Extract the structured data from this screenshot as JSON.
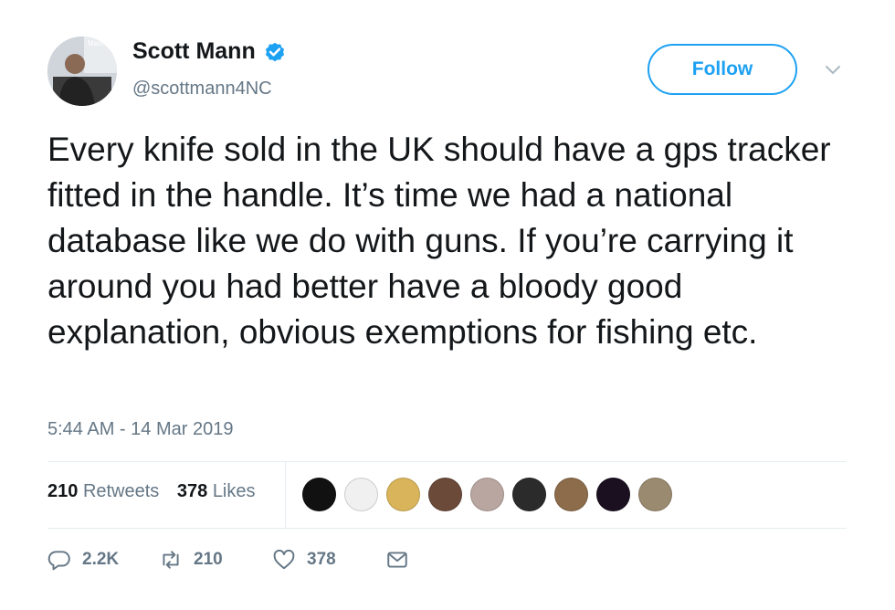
{
  "author": {
    "display_name": "Scott Mann",
    "handle": "@scottmann4NC",
    "verified": true,
    "avatar_text": "Mann"
  },
  "follow_button": {
    "label": "Follow"
  },
  "tweet": {
    "text": "Every knife sold in the UK should have a gps tracker fitted in the handle. It’s time we had a national database like we do with guns. If you’re carrying it around you had better have a bloody good explanation, obvious exemptions for fishing etc.",
    "timestamp": "5:44 AM - 14 Mar 2019"
  },
  "stats": {
    "retweets_count": "210",
    "retweets_label": "Retweets",
    "likes_count": "378",
    "likes_label": "Likes"
  },
  "liker_avatars": [
    "#111111",
    "#f0f0f0",
    "#d9b45a",
    "#6b4a3a",
    "#b9a6a0",
    "#2b2b2b",
    "#8c6c4a",
    "#1a1020",
    "#9a8a70"
  ],
  "actions": {
    "reply_count": "2.2K",
    "retweet_count": "210",
    "like_count": "378"
  },
  "colors": {
    "accent": "#1da1f2",
    "text": "#14171a",
    "secondary": "#657786",
    "divider": "#e6ecf0"
  }
}
